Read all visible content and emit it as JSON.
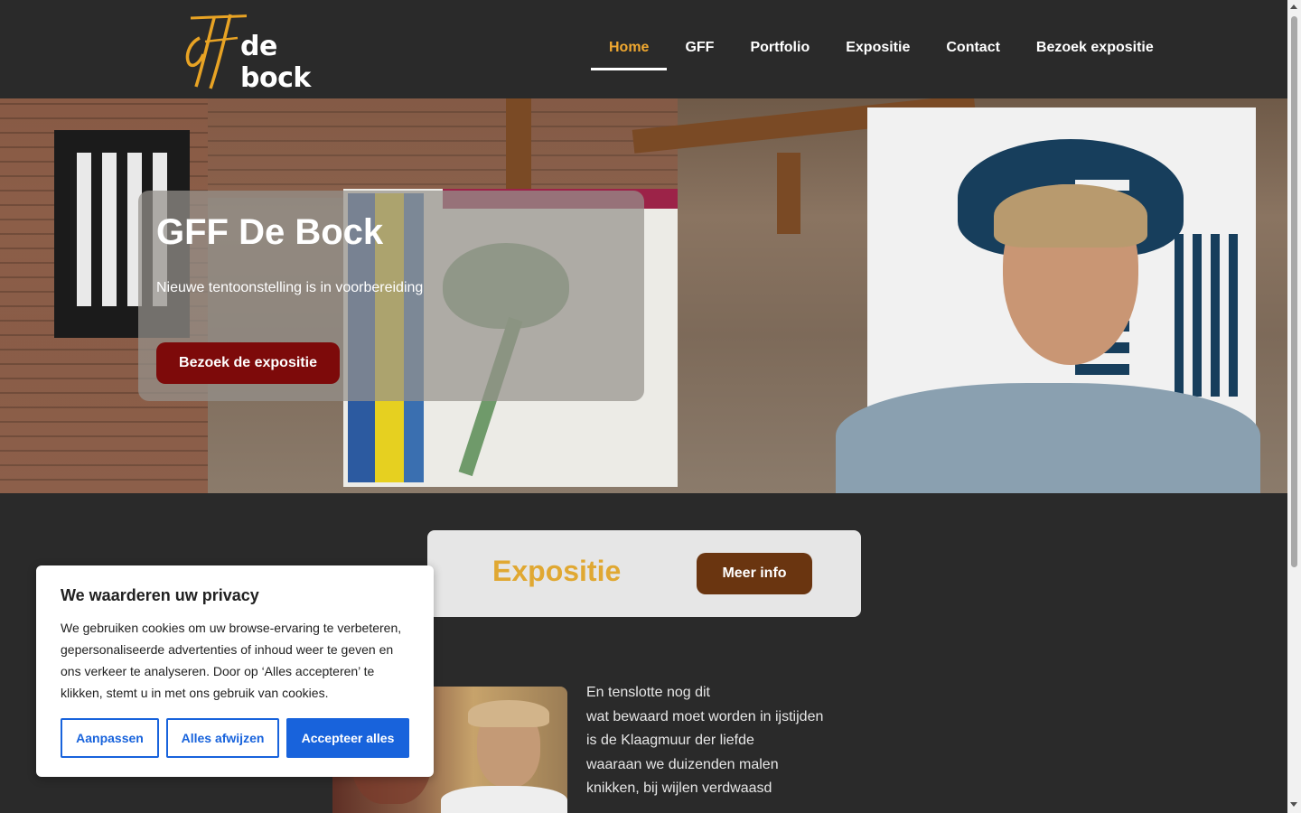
{
  "header": {
    "logo_text": "de bock",
    "nav": [
      {
        "label": "Home",
        "active": true
      },
      {
        "label": "GFF",
        "active": false
      },
      {
        "label": "Portfolio",
        "active": false
      },
      {
        "label": "Expositie",
        "active": false
      },
      {
        "label": "Contact",
        "active": false
      },
      {
        "label": "Bezoek expositie",
        "active": false
      }
    ]
  },
  "hero": {
    "title": "GFF De Bock",
    "subtitle": "Nieuwe tentoonstelling is in voorbereiding",
    "button": "Bezoek de expositie"
  },
  "expo": {
    "title": "Expositie",
    "button": "Meer info"
  },
  "poem": {
    "lines": [
      "En tenslotte nog dit",
      "wat bewaard moet worden in ijstijden",
      "is de Klaagmuur der liefde",
      "waaraan we duizenden malen",
      "knikken, bij wijlen verdwaasd"
    ]
  },
  "cookie": {
    "title": "We waarderen uw privacy",
    "text": "We gebruiken cookies om uw browse-ervaring te verbeteren, gepersonaliseerde advertenties of inhoud weer te geven en ons verkeer te analyseren. Door op ‘Alles accepteren’ te klikken, stemt u in met ons gebruik van cookies.",
    "btn_customize": "Aanpassen",
    "btn_reject": "Alles afwijzen",
    "btn_accept": "Accepteer alles"
  },
  "colors": {
    "accent": "#f0a830",
    "hero_button": "#7d0a0a",
    "expo_button": "#6a3510",
    "cookie_blue": "#1863dc"
  }
}
